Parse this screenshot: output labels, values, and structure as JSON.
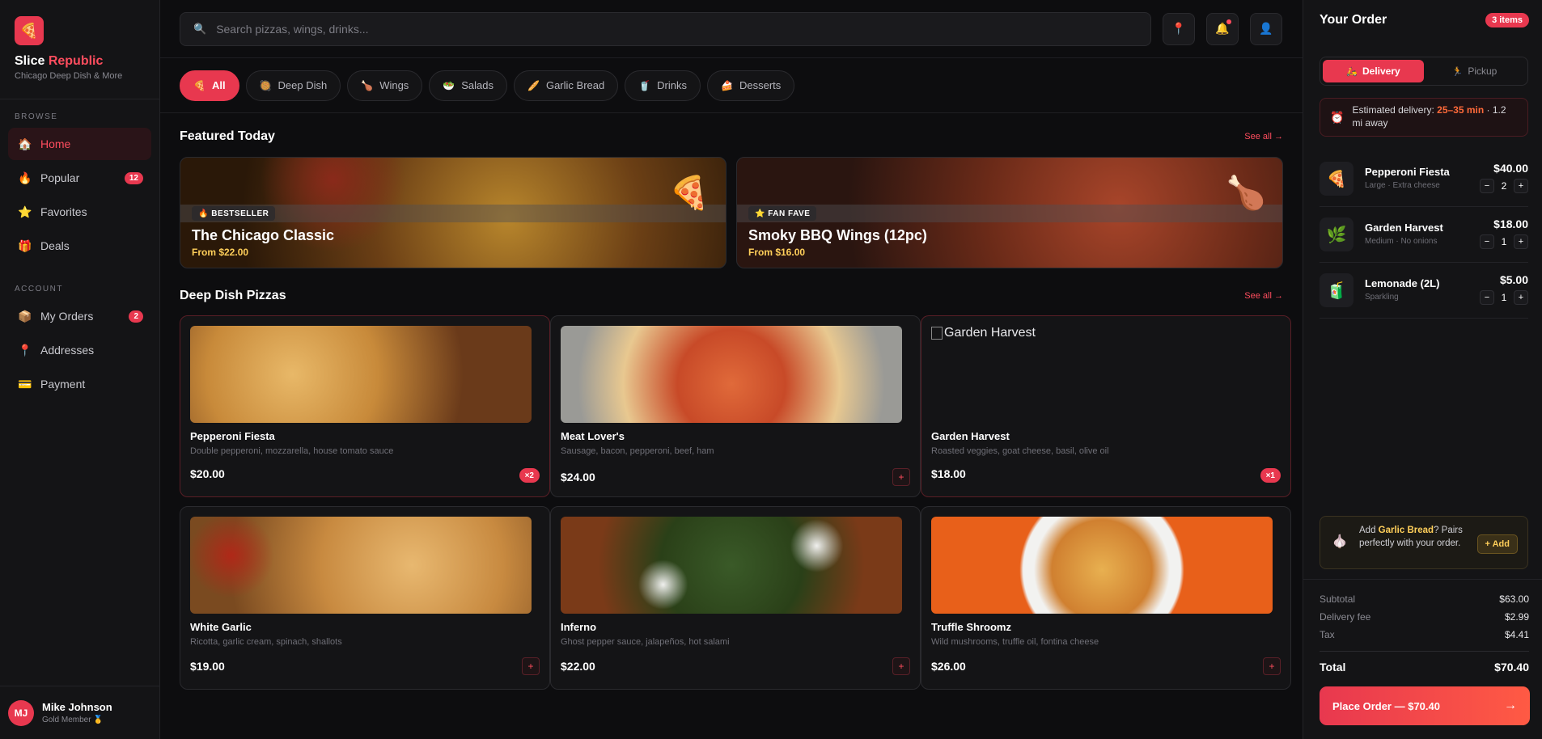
{
  "brand": {
    "name_a": "Slice",
    "name_b": "Republic",
    "tagline": "Chicago Deep Dish & More",
    "logo_icon": "🍕"
  },
  "sidebar": {
    "browse_title": "BROWSE",
    "browse": [
      {
        "label": "Home",
        "icon": "🏠"
      },
      {
        "label": "Popular",
        "icon": "🔥",
        "badge": "12"
      },
      {
        "label": "Favorites",
        "icon": "⭐"
      },
      {
        "label": "Deals",
        "icon": "🎁"
      }
    ],
    "account_title": "ACCOUNT",
    "account": [
      {
        "label": "My Orders",
        "icon": "📦",
        "badge": "2"
      },
      {
        "label": "Addresses",
        "icon": "📍"
      },
      {
        "label": "Payment",
        "icon": "💳"
      }
    ]
  },
  "user": {
    "initials": "MJ",
    "name": "Mike Johnson",
    "role": "Gold Member 🥇"
  },
  "search": {
    "placeholder": "Search pizzas, wings, drinks..."
  },
  "top_icons": {
    "location": "📍",
    "bell": "🔔",
    "profile": "👤"
  },
  "categories": [
    {
      "label": "All",
      "icon": "🍕"
    },
    {
      "label": "Deep Dish",
      "icon": "🥘"
    },
    {
      "label": "Wings",
      "icon": "🍗"
    },
    {
      "label": "Salads",
      "icon": "🥗"
    },
    {
      "label": "Garlic Bread",
      "icon": "🥖"
    },
    {
      "label": "Drinks",
      "icon": "🥤"
    },
    {
      "label": "Desserts",
      "icon": "🍰"
    }
  ],
  "featured": {
    "title": "Featured Today",
    "see_all": "See all →",
    "cards": [
      {
        "tag": "BESTSELLER",
        "tag_icon": "🔥",
        "title": "The Chicago Classic",
        "price": "From $22.00",
        "emoji": "🍕"
      },
      {
        "tag": "FAN FAVE",
        "tag_icon": "⭐",
        "title": "Smoky BBQ Wings (12pc)",
        "price": "From $16.00",
        "emoji": "🍗"
      }
    ]
  },
  "deep_dish": {
    "title": "Deep Dish Pizzas",
    "see_all": "See all →",
    "items": [
      {
        "name": "Pepperoni Fiesta",
        "desc": "Double pepperoni, mozzarella, house tomato sauce",
        "price": "$20.00",
        "qty": "×2"
      },
      {
        "name": "Meat Lover's",
        "desc": "Sausage, bacon, pepperoni, beef, ham",
        "price": "$24.00",
        "add": "+"
      },
      {
        "name": "Garden Harvest",
        "desc": "Roasted veggies, goat cheese, basil, olive oil",
        "price": "$18.00",
        "qty": "×1",
        "img_alt": "Garden Harvest"
      },
      {
        "name": "White Garlic",
        "desc": "Ricotta, garlic cream, spinach, shallots",
        "price": "$19.00",
        "add": "+"
      },
      {
        "name": "Inferno",
        "desc": "Ghost pepper sauce, jalapeños, hot salami",
        "price": "$22.00",
        "add": "+"
      },
      {
        "name": "Truffle Shroomz",
        "desc": "Wild mushrooms, truffle oil, fontina cheese",
        "price": "$26.00",
        "add": "+"
      }
    ]
  },
  "order": {
    "title": "Your Order",
    "count": "3 items",
    "delivery_label": "Delivery",
    "delivery_icon": "🛵",
    "pickup_label": "Pickup",
    "pickup_icon": "🏃",
    "eta_icon": "⏰",
    "eta_prefix": "Estimated delivery: ",
    "eta_time": "25–35 min",
    "eta_suffix": " · 1.2 mi away",
    "items": [
      {
        "name": "Pepperoni Fiesta",
        "note": "Large · Extra cheese",
        "price": "$40.00",
        "qty": "2",
        "icon": "🍕"
      },
      {
        "name": "Garden Harvest",
        "note": "Medium · No onions",
        "price": "$18.00",
        "qty": "1",
        "icon": "🌿"
      },
      {
        "name": "Lemonade (2L)",
        "note": "Sparkling",
        "price": "$5.00",
        "qty": "1",
        "icon": "🧃"
      }
    ],
    "minus": "−",
    "plus": "+",
    "upsell": {
      "icon": "🧄",
      "pre": "Add ",
      "highlight": "Garlic Bread",
      "post": "? Pairs perfectly with your order.",
      "button": "+ Add"
    },
    "subtotal_label": "Subtotal",
    "subtotal": "$63.00",
    "fee_label": "Delivery fee",
    "fee": "$2.99",
    "tax_label": "Tax",
    "tax": "$4.41",
    "total_label": "Total",
    "total": "$70.40",
    "place_label": "Place Order — $70.40",
    "place_arrow": "→"
  }
}
